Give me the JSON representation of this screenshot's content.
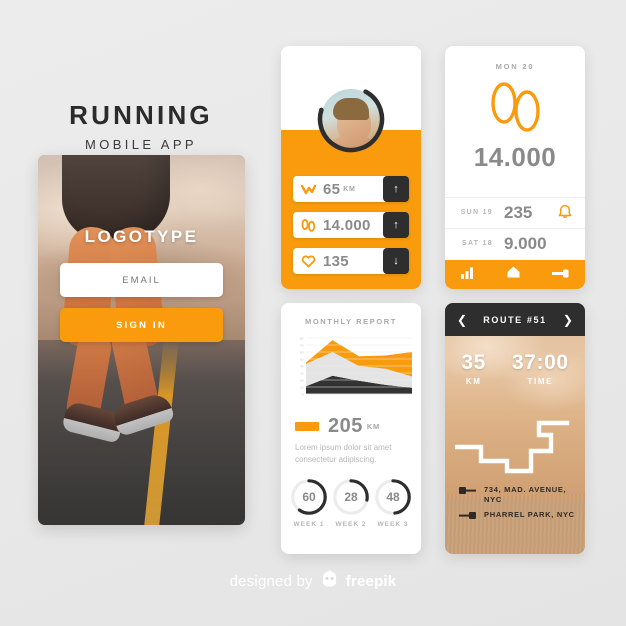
{
  "hero": {
    "title": "RUNNING",
    "subtitle": "MOBILE APP"
  },
  "login_screen": {
    "logotype": "LOGOTYPE",
    "email_placeholder": "EMAIL",
    "email_value": "",
    "signin_label": "SIGN IN"
  },
  "profile_card": {
    "avatar_icon": "user-avatar-photo",
    "progress_ring_icon": "avatar-progress-ring",
    "stats": [
      {
        "icon": "zigzag-route-icon",
        "value": "65",
        "unit": "KM",
        "trend": "up",
        "trend_icon": "arrow-up-icon"
      },
      {
        "icon": "footprints-icon",
        "value": "14.000",
        "unit": "",
        "trend": "up",
        "trend_icon": "arrow-up-icon"
      },
      {
        "icon": "heart-icon",
        "value": "135",
        "unit": "",
        "trend": "down",
        "trend_icon": "arrow-down-icon"
      }
    ]
  },
  "daily_card": {
    "date_label": "MON 20",
    "footprints_icon": "footprints-icon",
    "steps": "14.000",
    "days": [
      {
        "label": "SUN 19",
        "value": "235",
        "icon": "bell-icon"
      },
      {
        "label": "SAT 18",
        "value": "9.000",
        "icon": ""
      }
    ],
    "nav": [
      {
        "name": "stats-nav-item",
        "icon": "bar-chart-icon"
      },
      {
        "name": "home-nav-item",
        "icon": "home-icon"
      },
      {
        "name": "route-nav-item",
        "icon": "key-icon"
      }
    ]
  },
  "report_card": {
    "title": "MONTHLY REPORT",
    "total": "205",
    "total_unit": "KM",
    "description": "Lorem ipsum dolor sit amet consectetur adipiscing.",
    "weeks": [
      {
        "value": "60",
        "label": "WEEK 1",
        "percent": 60
      },
      {
        "value": "28",
        "label": "WEEK 2",
        "percent": 28
      },
      {
        "value": "48",
        "label": "WEEK 3",
        "percent": 48
      }
    ]
  },
  "chart_data": {
    "type": "area",
    "title": "MONTHLY REPORT",
    "xlabel": "",
    "ylabel": "",
    "ylim": [
      0,
      80
    ],
    "yticks": [
      0,
      10,
      20,
      30,
      40,
      50,
      60,
      70,
      80
    ],
    "grid": true,
    "legend": [
      "205 KM"
    ],
    "legend_position": "below",
    "x": [
      0,
      1,
      2,
      3,
      4
    ],
    "stacked": true,
    "series": [
      {
        "name": "dark",
        "color": "#333333",
        "values": [
          11,
          26,
          19,
          13,
          9
        ]
      },
      {
        "name": "light",
        "color": "#e4e4e4",
        "values": [
          32,
          34,
          21,
          23,
          16
        ]
      },
      {
        "name": "orange",
        "color": "#f99b0c",
        "values": [
          2,
          17,
          14,
          19,
          35
        ]
      }
    ],
    "totals": [
      45,
      77,
      54,
      55,
      60
    ]
  },
  "route_card": {
    "prev_icon": "chevron-left-icon",
    "route_name": "ROUTE #51",
    "next_icon": "chevron-right-icon",
    "stats": [
      {
        "value": "35",
        "label": "KM"
      },
      {
        "value": "37:00",
        "label": "TIME"
      }
    ],
    "map_icon": "route-path-icon",
    "addresses": [
      {
        "icon": "start-pin-icon",
        "text": "734, MAD. AVENUE, NYC"
      },
      {
        "icon": "end-pin-icon",
        "text": "PHARREL PARK, NYC"
      }
    ]
  },
  "footer": {
    "prefix": "designed by",
    "logo_icon": "freepik-logo-icon",
    "brand": "freepik"
  },
  "colors": {
    "accent": "#f99b0c",
    "dark": "#2e2e2e",
    "muted": "#8a8a8a",
    "background": "#ececec"
  }
}
